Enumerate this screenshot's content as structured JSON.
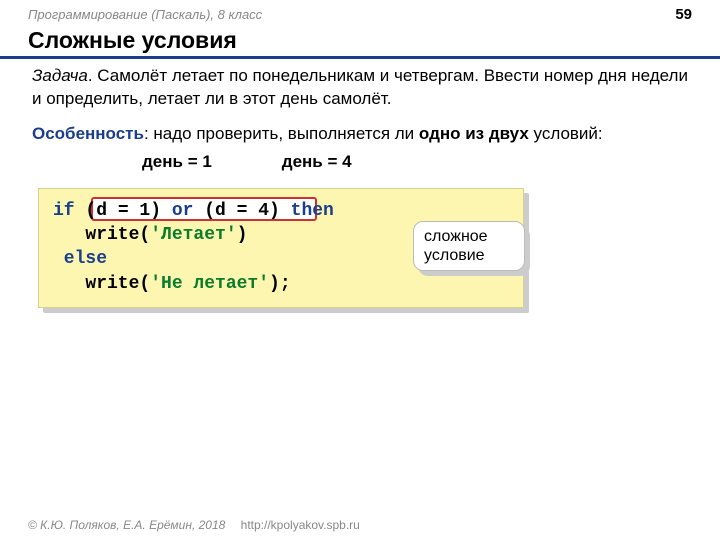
{
  "header": {
    "course": "Программирование (Паскаль), 8 класс",
    "page": "59"
  },
  "title": "Сложные условия",
  "task": {
    "label": "Задача",
    "text": ". Самолёт летает по понедельникам и четвергам. Ввести номер дня недели и определить, летает ли в этот день самолёт."
  },
  "feature": {
    "label": "Особенность",
    "before": ": надо проверить, выполняется ли ",
    "bold": "одно из двух",
    "after": " условий:"
  },
  "conditions": {
    "c1": "день = 1",
    "c2": "день = 4"
  },
  "code": {
    "l1_if": "if",
    "l1_cond1": " (d = 1) ",
    "l1_or": "or",
    "l1_cond2": " (d = 4) ",
    "l1_then": "then",
    "l2_pre": "   write(",
    "l2_str": "'Летает'",
    "l2_post": ")",
    "l3": " else",
    "l4_pre": "   write(",
    "l4_str": "'Не летает'",
    "l4_post": ");"
  },
  "callout": "сложное условие",
  "footer": {
    "copyright": "© К.Ю. Поляков, Е.А. Ерёмин, 2018",
    "link": "http://kpolyakov.spb.ru"
  }
}
